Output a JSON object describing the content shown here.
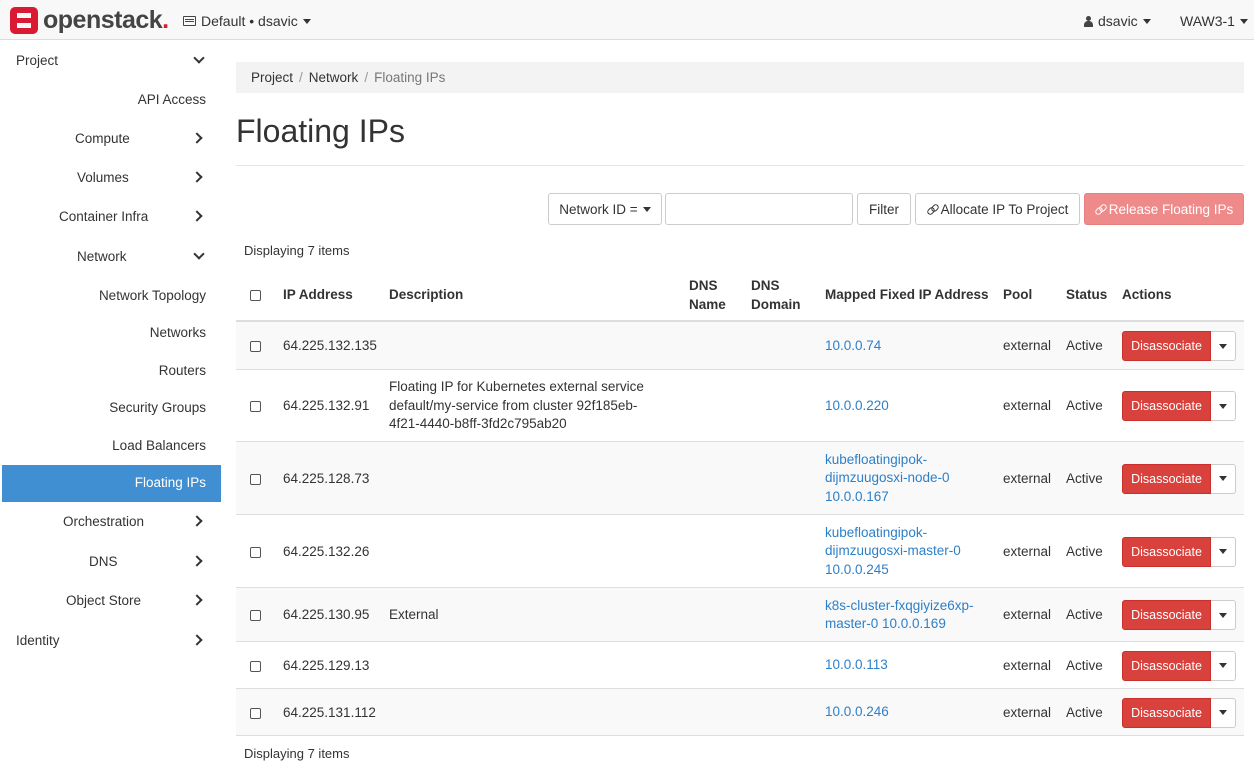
{
  "topbar": {
    "logo_text": "openstack",
    "logo_dot": ".",
    "project_switcher": "Default • dsavic",
    "user": "dsavic",
    "region": "WAW3-1"
  },
  "sidebar": {
    "project": "Project",
    "api_access": "API Access",
    "compute": "Compute",
    "volumes": "Volumes",
    "container_infra": "Container Infra",
    "network": "Network",
    "network_topology": "Network Topology",
    "networks": "Networks",
    "routers": "Routers",
    "security_groups": "Security Groups",
    "load_balancers": "Load Balancers",
    "floating_ips": "Floating IPs",
    "orchestration": "Orchestration",
    "dns": "DNS",
    "object_store": "Object Store",
    "identity": "Identity"
  },
  "breadcrumb": {
    "project": "Project",
    "network": "Network",
    "current": "Floating IPs",
    "sep": "/"
  },
  "page_title": "Floating IPs",
  "toolbar": {
    "filter_field": "Network ID =",
    "filter_value": "",
    "filter_button": "Filter",
    "allocate_button": "Allocate IP To Project",
    "release_button": "Release Floating IPs"
  },
  "item_count": "Displaying 7 items",
  "table": {
    "headers": {
      "ip": "IP Address",
      "description": "Description",
      "dns_name_1": "DNS",
      "dns_name_2": "Name",
      "dns_domain_1": "DNS",
      "dns_domain_2": "Domain",
      "mapped": "Mapped Fixed IP Address",
      "pool": "Pool",
      "status": "Status",
      "actions": "Actions"
    },
    "action_label": "Disassociate",
    "rows": [
      {
        "ip": "64.225.132.135",
        "desc": [
          "",
          "",
          ""
        ],
        "mapped": [
          "10.0.0.74",
          "",
          ""
        ],
        "pool": "external",
        "status": "Active"
      },
      {
        "ip": "64.225.132.91",
        "desc": [
          "Floating IP for Kubernetes external service",
          "default/my-service from cluster 92f185eb-",
          "4f21-4440-b8ff-3fd2c795ab20"
        ],
        "mapped": [
          "10.0.0.220",
          "",
          ""
        ],
        "pool": "external",
        "status": "Active"
      },
      {
        "ip": "64.225.128.73",
        "desc": [
          "",
          "",
          ""
        ],
        "mapped": [
          "kubefloatingipok-",
          "dijmzuugosxi-node-0",
          "10.0.0.167"
        ],
        "pool": "external",
        "status": "Active"
      },
      {
        "ip": "64.225.132.26",
        "desc": [
          "",
          "",
          ""
        ],
        "mapped": [
          "kubefloatingipok-",
          "dijmzuugosxi-master-0",
          "10.0.0.245"
        ],
        "pool": "external",
        "status": "Active"
      },
      {
        "ip": "64.225.130.95",
        "desc": [
          "External",
          "",
          ""
        ],
        "mapped": [
          "k8s-cluster-fxqgiyize6xp-",
          "master-0 10.0.0.169",
          ""
        ],
        "pool": "external",
        "status": "Active"
      },
      {
        "ip": "64.225.129.13",
        "desc": [
          "",
          "",
          ""
        ],
        "mapped": [
          "10.0.0.113",
          "",
          ""
        ],
        "pool": "external",
        "status": "Active"
      },
      {
        "ip": "64.225.131.112",
        "desc": [
          "",
          "",
          ""
        ],
        "mapped": [
          "10.0.0.246",
          "",
          ""
        ],
        "pool": "external",
        "status": "Active"
      }
    ]
  },
  "footer_count": "Displaying 7 items"
}
